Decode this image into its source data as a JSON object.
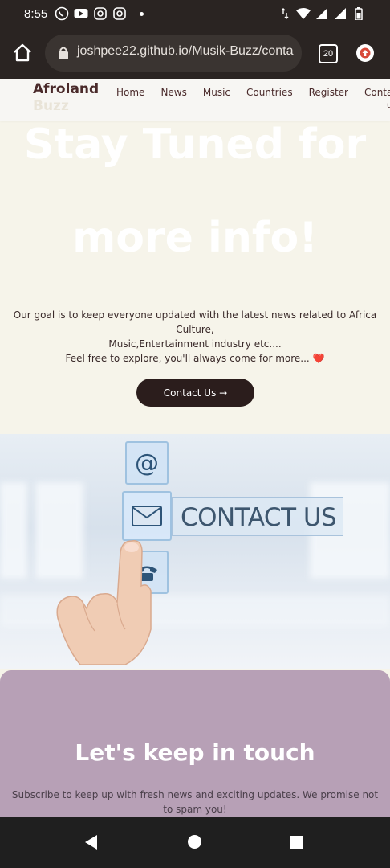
{
  "status_bar": {
    "time": "8:55"
  },
  "browser": {
    "url": "joshpee22.github.io/Musik-Buzz/conta",
    "tab_count": "20"
  },
  "site": {
    "logo_line1": "Afroland",
    "logo_line2": "Buzz",
    "nav": [
      {
        "label": "Home"
      },
      {
        "label": "News"
      },
      {
        "label": "Music"
      },
      {
        "label": "Countries"
      },
      {
        "label": "Register"
      },
      {
        "label": "Conta"
      }
    ],
    "nav_suffix": "u"
  },
  "hero": {
    "title_line1": "Stay Tuned for",
    "title_line2": "more info!",
    "desc_line1": "Our goal is to keep everyone updated with the latest news related to Africa Culture,",
    "desc_line2": "Music,Entertainment industry etc....",
    "desc_line3": "Feel free to explore, you'll always come for more... ❤️",
    "contact_button": "Contact Us →"
  },
  "contact_image": {
    "banner_text": "CONTACT US"
  },
  "subscribe": {
    "title": "Let's keep in touch",
    "desc": "Subscribe to keep up with fresh news and exciting updates. We promise not to spam you!"
  }
}
